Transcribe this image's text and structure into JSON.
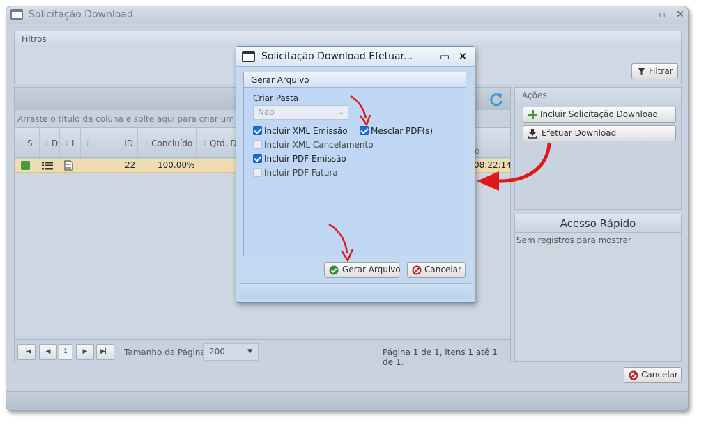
{
  "window": {
    "title": "Solicitação Download"
  },
  "filters": {
    "header": "Filtros",
    "filter_button": "Filtrar"
  },
  "grid": {
    "group_hint": "Arraste o título da coluna e solte aqui para criar um agrup",
    "columns": [
      "S",
      "D",
      "L",
      "ID",
      "Concluído",
      "Qtd. D"
    ],
    "row": {
      "id": "22",
      "concluido": "100.00%",
      "time": "08:22:14",
      "partial_header": "o"
    },
    "pager": {
      "current_page": "1",
      "page_size_label": "Tamanho da Página",
      "page_size": "200",
      "summary": "Página 1 de 1, itens 1 até 1 de 1."
    }
  },
  "actions": {
    "header": "Ações",
    "include_button": "Incluir Solicitação Download",
    "download_button": "Efetuar Download"
  },
  "quick_access": {
    "header": "Acesso Rápido",
    "empty": "Sem registros para mostrar"
  },
  "footer": {
    "cancel_button": "Cancelar"
  },
  "modal": {
    "title": "Solicitação Download Efetuar...",
    "panel_header": "Gerar Arquivo",
    "criar_pasta_label": "Criar Pasta",
    "criar_pasta_value": "Não",
    "checkboxes": [
      {
        "label": "Incluir XML Emissão",
        "checked": true
      },
      {
        "label": "Mesclar PDF(s)",
        "checked": true
      },
      {
        "label": "Incluir XML Cancelamento",
        "checked": false
      },
      {
        "label": "Incluir PDF Emissão",
        "checked": true
      },
      {
        "label": "Incluir PDF Fatura",
        "checked": false
      }
    ],
    "generate_button": "Gerar Arquivo",
    "cancel_button": "Cancelar"
  },
  "colors": {
    "accent_red": "#e01818",
    "check_blue": "#1d6fd8",
    "row_highlight": "#efdcb0"
  }
}
